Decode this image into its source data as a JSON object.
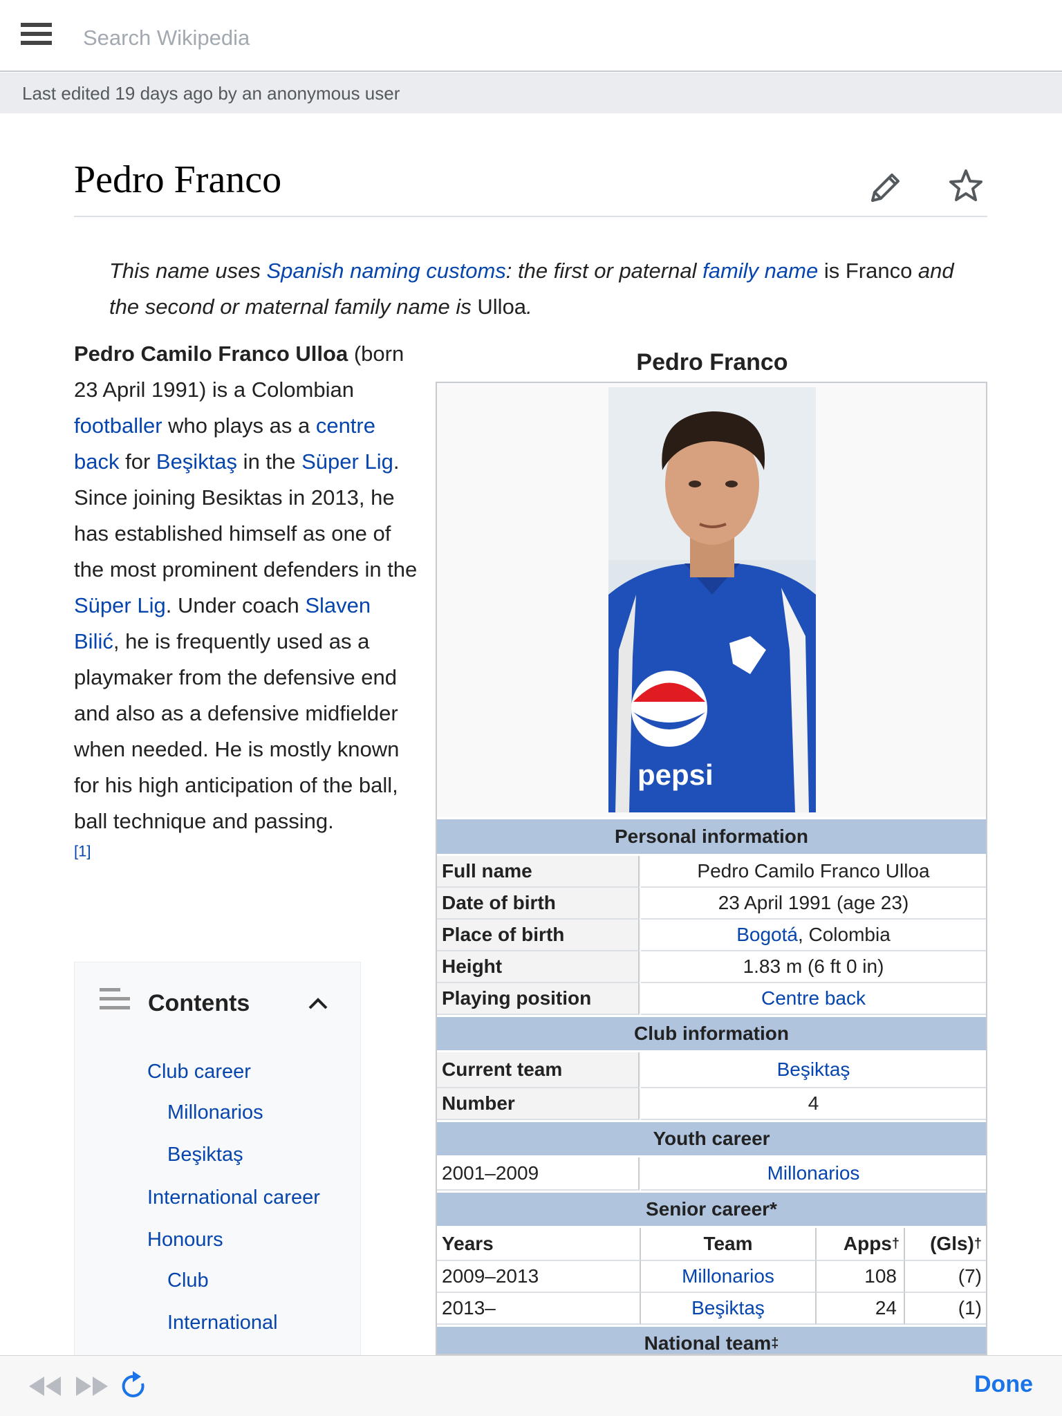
{
  "search": {
    "placeholder": "Search Wikipedia"
  },
  "edited": "Last edited 19 days ago by an anonymous user",
  "title": "Pedro Franco",
  "hatnote": {
    "t1": "This name uses ",
    "l1": "Spanish naming customs",
    "t2": ": the first or paternal ",
    "l2": "family name",
    "t3": " is ",
    "n1": "Franco",
    "t4": " and the second or maternal family name is ",
    "n2": "Ulloa",
    "t5": "."
  },
  "lead": {
    "name": "Pedro Camilo Franco Ulloa",
    "t1": " (born 23 April 1991) is a Colombian ",
    "l_footballer": "footballer",
    "t2": " who plays as a ",
    "l_centreback": "centre back",
    "t3": " for ",
    "l_besiktas": "Beşiktaş",
    "t4": " in the ",
    "l_superlig1": "Süper Lig",
    "t5": ". Since joining Besiktas in 2013, he has established himself as one of the most prominent defenders in the ",
    "l_superlig2": "Süper Lig",
    "t6": ". Under coach ",
    "l_bilic": "Slaven Bilić",
    "t7": ", he is frequently used as a playmaker from the defensive end and also as a defensive midfielder when needed. He is mostly known for his high anticipation of the ball, ball technique and passing.",
    "ref": "[1]"
  },
  "toc": {
    "title": "Contents",
    "items": [
      "Club career",
      "Millonarios",
      "Beşiktaş",
      "International career",
      "Honours",
      "Club",
      "International"
    ]
  },
  "infobox": {
    "caption": "Pedro Franco",
    "photo_text": "pepsi",
    "personal_hdr": "Personal information",
    "full_name_lbl": "Full name",
    "full_name": "Pedro Camilo Franco Ulloa",
    "dob_lbl": "Date of birth",
    "dob": "23 April 1991 (age 23)",
    "pob_lbl": "Place of birth",
    "pob_link": "Bogotá",
    "pob_rest": ", Colombia",
    "height_lbl": "Height",
    "height": "1.83 m (6 ft 0 in)",
    "position_lbl": "Playing position",
    "position": "Centre back",
    "club_hdr": "Club information",
    "current_team_lbl": "Current team",
    "current_team": "Beşiktaş",
    "number_lbl": "Number",
    "number": "4",
    "youth_hdr": "Youth career",
    "youth_years": "2001–2009",
    "youth_team": "Millonarios",
    "senior_hdr": "Senior career*",
    "col_years": "Years",
    "col_team": "Team",
    "col_apps": "Apps",
    "col_gls": "(Gls)",
    "dagger": "†",
    "senior": [
      {
        "years": "2009–2013",
        "team": "Millonarios",
        "apps": "108",
        "gls": "(7)"
      },
      {
        "years": "2013–",
        "team": "Beşiktaş",
        "apps": "24",
        "gls": "(1)"
      }
    ],
    "national_hdr": "National team",
    "ddagger": "‡"
  },
  "toolbar": {
    "done": "Done"
  },
  "colors": {
    "link": "#0645ad",
    "infobox_header": "#b0c4de",
    "done": "#1a73e8"
  }
}
